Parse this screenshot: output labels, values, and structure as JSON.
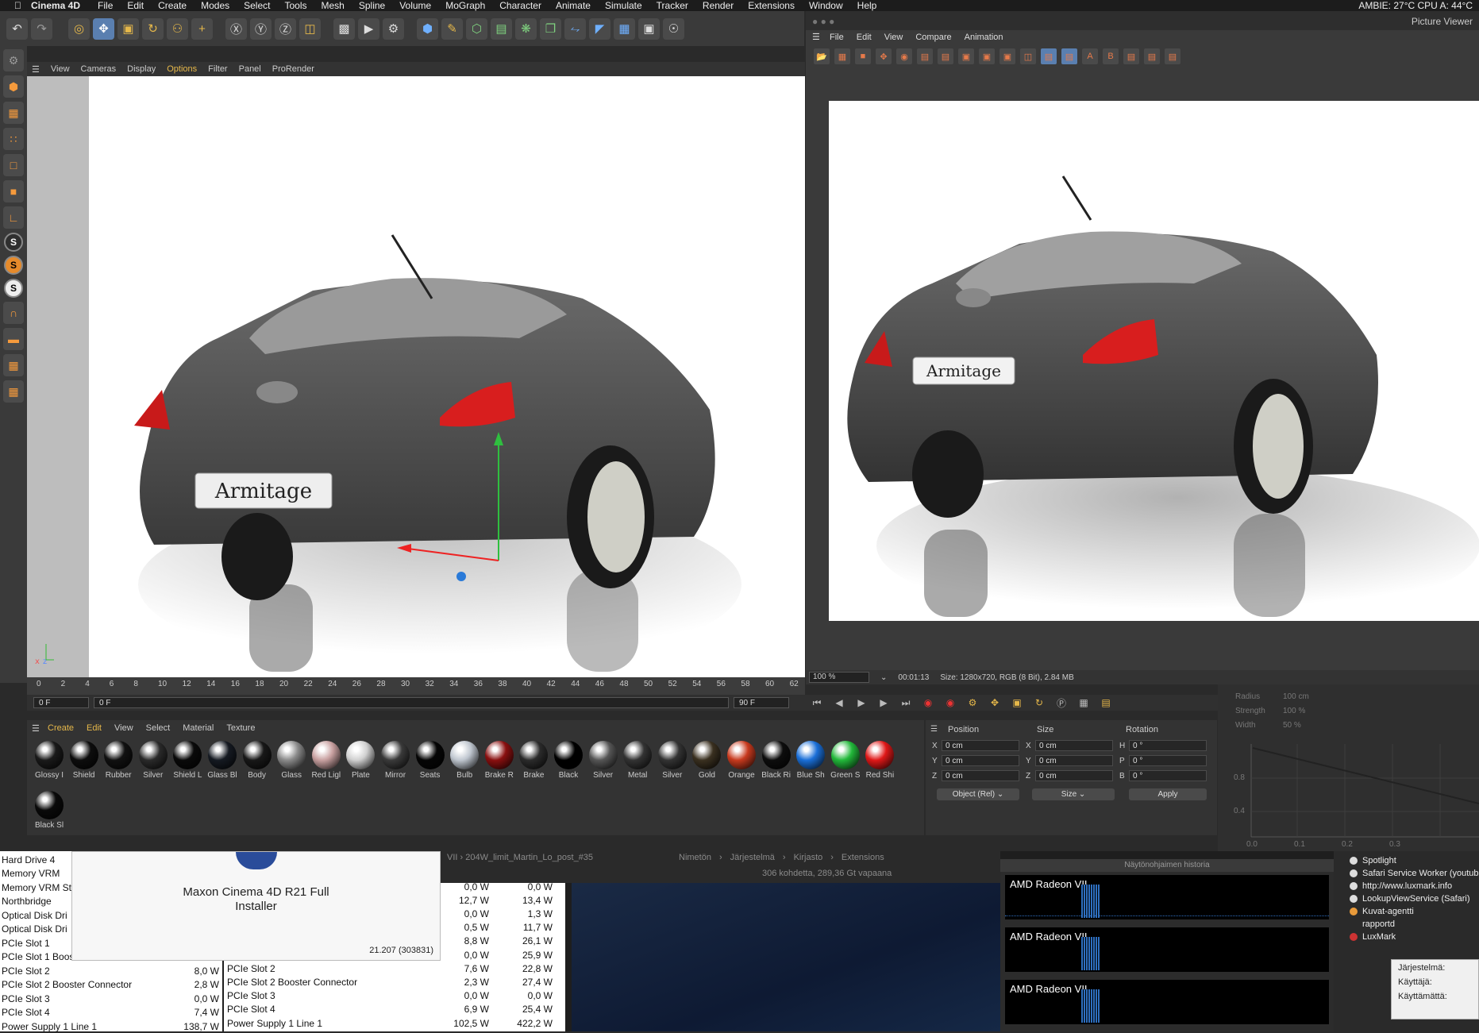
{
  "menubar": {
    "app": "Cinema 4D",
    "items": [
      "File",
      "Edit",
      "Create",
      "Modes",
      "Select",
      "Tools",
      "Mesh",
      "Spline",
      "Volume",
      "MoGraph",
      "Character",
      "Animate",
      "Simulate",
      "Tracker",
      "Render",
      "Extensions",
      "Window",
      "Help"
    ],
    "status": "AMBIE: 27°C CPU A: 44°C"
  },
  "viewport": {
    "menu": [
      "View",
      "Cameras",
      "Display",
      "Options",
      "Filter",
      "Panel",
      "ProRender"
    ],
    "plate_text": "Armitage"
  },
  "timeline": {
    "ticks": [
      "0",
      "2",
      "4",
      "6",
      "8",
      "10",
      "12",
      "14",
      "16",
      "18",
      "20",
      "22",
      "24",
      "26",
      "28",
      "30",
      "32",
      "34",
      "36",
      "38",
      "40",
      "42",
      "44",
      "46",
      "48",
      "50",
      "52",
      "54",
      "56",
      "58",
      "60",
      "62"
    ],
    "start_frame": "0 F",
    "current_frame": "0 F",
    "end_frame": "90 F",
    "max_frame": "90 F"
  },
  "materials": {
    "menu": [
      "Create",
      "Edit",
      "View",
      "Select",
      "Material",
      "Texture"
    ],
    "items": [
      {
        "name": "Glossy I",
        "color": "#1a1a1a"
      },
      {
        "name": "Shield",
        "color": "#0d0d0d"
      },
      {
        "name": "Rubber",
        "color": "#111111"
      },
      {
        "name": "Silver",
        "color": "#2a2a2a"
      },
      {
        "name": "Shield L",
        "color": "#0a0a0a"
      },
      {
        "name": "Glass Bl",
        "color": "#151a22"
      },
      {
        "name": "Body",
        "color": "#181818"
      },
      {
        "name": "Glass",
        "color": "#8a8a8a"
      },
      {
        "name": "Red Ligl",
        "color": "#c8a0a0"
      },
      {
        "name": "Plate",
        "color": "#d0d0d0"
      },
      {
        "name": "Mirror",
        "color": "#3a3a3a"
      },
      {
        "name": "Seats",
        "color": "#050505"
      },
      {
        "name": "Bulb",
        "color": "#bfc6cf"
      },
      {
        "name": "Brake R",
        "color": "#8a1010"
      },
      {
        "name": "Brake",
        "color": "#2b2b2b"
      },
      {
        "name": "Black",
        "color": "#000000"
      },
      {
        "name": "Silver",
        "color": "#555555"
      },
      {
        "name": "Metal",
        "color": "#333333"
      },
      {
        "name": "Silver",
        "color": "#333333"
      },
      {
        "name": "Gold",
        "color": "#3a3020"
      },
      {
        "name": "Orange",
        "color": "#c83a1e"
      },
      {
        "name": "Black Ri",
        "color": "#0d0d0d"
      },
      {
        "name": "Blue Sh",
        "color": "#1a6fd8"
      },
      {
        "name": "Green S",
        "color": "#22b83a"
      },
      {
        "name": "Red Shi",
        "color": "#e01818"
      },
      {
        "name": "Black Sl",
        "color": "#0a0a0a"
      }
    ]
  },
  "coords": {
    "headers": [
      "Position",
      "Size",
      "Rotation"
    ],
    "rows": [
      {
        "axis": "X",
        "pos": "0 cm",
        "saxis": "X",
        "size": "0 cm",
        "raxis": "H",
        "rot": "0 °"
      },
      {
        "axis": "Y",
        "pos": "0 cm",
        "saxis": "Y",
        "size": "0 cm",
        "raxis": "P",
        "rot": "0 °"
      },
      {
        "axis": "Z",
        "pos": "0 cm",
        "saxis": "Z",
        "size": "0 cm",
        "raxis": "B",
        "rot": "0 °"
      }
    ],
    "mode": "Object (Rel)",
    "size_mode": "Size",
    "apply": "Apply"
  },
  "picture_viewer": {
    "title": "Picture Viewer",
    "menu": [
      "File",
      "Edit",
      "View",
      "Compare",
      "Animation"
    ],
    "zoom": "100 %",
    "time": "00:01:13",
    "info": "Size: 1280x720, RGB (8 Bit), 2.84 MB",
    "plate_text": "Armitage"
  },
  "graph_panel": {
    "labels": [
      "Radius",
      "Strength",
      "Width"
    ],
    "values": [
      "100 cm",
      "100 %",
      "50 %"
    ],
    "y_ticks": [
      "0.8",
      "0.4"
    ],
    "x_ticks": [
      "0.0",
      "0.1",
      "0.2",
      "0.3"
    ]
  },
  "power": {
    "col1": [
      {
        "name": "Hard Drive 4",
        "v": ""
      },
      {
        "name": "Memory VRM",
        "v": ""
      },
      {
        "name": "Memory VRM St",
        "v": ""
      },
      {
        "name": "Northbridge",
        "v": ""
      },
      {
        "name": "Optical Disk Dri",
        "v": ""
      },
      {
        "name": "Optical Disk Dri",
        "v": ""
      },
      {
        "name": "PCIe Slot 1",
        "v": ""
      },
      {
        "name": "PCIe Slot 1 Boos",
        "v": ""
      },
      {
        "name": "PCIe Slot 2",
        "v": "8,0 W"
      },
      {
        "name": "PCIe Slot 2 Booster Connector",
        "v": "2,8 W"
      },
      {
        "name": "PCIe Slot 3",
        "v": "0,0 W"
      },
      {
        "name": "PCIe Slot 4",
        "v": "7,4 W"
      },
      {
        "name": "Power Supply 1 Line 1",
        "v": "138,7 W"
      }
    ],
    "col2": [
      {
        "name": "",
        "a": "0,0 W",
        "b": "0,0 W"
      },
      {
        "name": "",
        "a": "12,7 W",
        "b": "13,4 W"
      },
      {
        "name": "",
        "a": "0,0 W",
        "b": "1,3 W"
      },
      {
        "name": "",
        "a": "0,5 W",
        "b": "11,7 W"
      },
      {
        "name": "",
        "a": "8,8 W",
        "b": "26,1 W"
      },
      {
        "name": "",
        "a": "0,0 W",
        "b": "25,9 W"
      },
      {
        "name": "PCIe Slot 2",
        "a": "7,6 W",
        "b": "22,8 W"
      },
      {
        "name": "PCIe Slot 2 Booster Connector",
        "a": "2,3 W",
        "b": "27,4 W"
      },
      {
        "name": "PCIe Slot 3",
        "a": "0,0 W",
        "b": "0,0 W"
      },
      {
        "name": "PCIe Slot 4",
        "a": "6,9 W",
        "b": "25,4 W"
      },
      {
        "name": "Power Supply 1 Line 1",
        "a": "102,5 W",
        "b": "422,2 W"
      }
    ]
  },
  "installer": {
    "title": "Maxon Cinema 4D R21 Full Installer",
    "version": "21.207 (303831)"
  },
  "finder": {
    "path1": "VII › 204W_limit_Martin_Lo_post_#35",
    "path2": [
      "Nimetön",
      "Järjestelmä",
      "Kirjasto",
      "Extensions"
    ],
    "status": "306 kohdetta, 289,36 Gt vapaana"
  },
  "gpu_history": {
    "title": "Näytönohjaimen historia",
    "panes": [
      "AMD Radeon VII",
      "AMD Radeon VII",
      "AMD Radeon VII"
    ]
  },
  "activity": {
    "items": [
      "Spotlight",
      "Safari Service Worker (youtube",
      "http://www.luxmark.info",
      "LookupViewService (Safari)",
      "Kuvat-agentti",
      "rapportd",
      "LuxMark"
    ],
    "box": [
      "Järjestelmä:",
      "Käyttäjä:",
      "Käyttämättä:"
    ]
  }
}
